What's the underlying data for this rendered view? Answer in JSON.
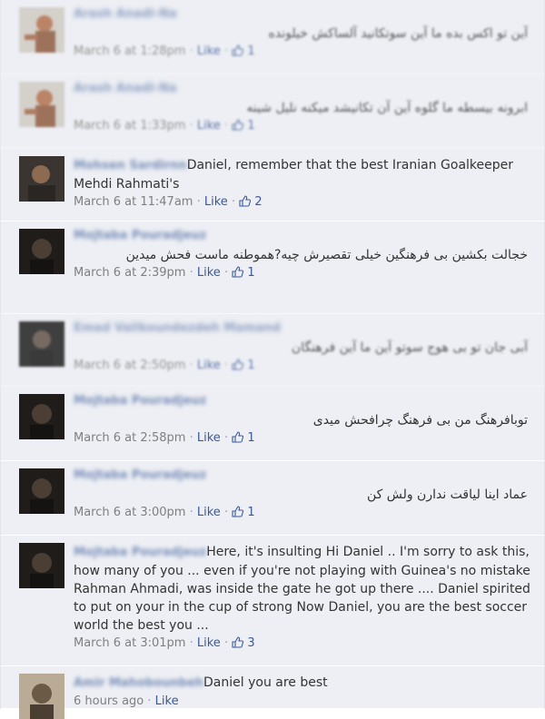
{
  "comments": [
    {
      "author": "Arash Anadi-Na",
      "text": "آين تو اکس بده ما آين سوتکانيد آلساکش خيلونده",
      "time": "March 6 at 1:28pm",
      "like_label": "Like",
      "likes": "1"
    },
    {
      "author": "Arash Anadi-Na",
      "text": "ابرونه بیسطه ما گلوه آين آن تکانیشد میکنه نلیل شینه",
      "time": "March 6 at 1:33pm",
      "like_label": "Like",
      "likes": "1"
    },
    {
      "author": "Mohsen Sardirnn",
      "text": "Daniel, remember that the best Iranian Goalkeeper Mehdi Rahmati's",
      "time": "March 6 at 11:47am",
      "like_label": "Like",
      "likes": "2"
    },
    {
      "author": "Mojtaba Pouradjeuz",
      "text": "خجالت بکشین بی فرهنگین خیلی تقصیرش چیه?هموطنه ماست فحش میدین",
      "time": "March 6 at 2:39pm",
      "like_label": "Like",
      "likes": "1"
    },
    {
      "author": "Emad Valikoundezdeh Mamand",
      "text": "آبی جان تو بی هوج سوتو آين ما آين فرهنگان",
      "time": "March 6 at 2:50pm",
      "like_label": "Like",
      "likes": "1"
    },
    {
      "author": "Mojtaba Pouradjeuz",
      "text": "توبافرهنگ من بی فرهنگ چرافحش میدی",
      "time": "March 6 at 2:58pm",
      "like_label": "Like",
      "likes": "1"
    },
    {
      "author": "Mojtaba Pouradjeuz",
      "text": "عماد اینا لیاقت ندارن ولش کن",
      "time": "March 6 at 3:00pm",
      "like_label": "Like",
      "likes": "1"
    },
    {
      "author": "Mojtaba Pouradjeuz",
      "text": "Here, it's insulting Hi Daniel .. I'm sorry to ask this, how many of you ... even if you're not playing with Guinea's no mistake Rahman Ahmadi, was inside the gate he got up there .... Daniel spirited to put on your in the cup of strong Now Daniel, you are the best soccer world the best you ...",
      "time": "March 6 at 3:01pm",
      "like_label": "Like",
      "likes": "3"
    },
    {
      "author": "Amir Mahobounbeh",
      "text": "Daniel you are best",
      "time": "6 hours ago",
      "like_label": "Like",
      "likes": ""
    }
  ],
  "colors": {
    "link": "#3b5998",
    "meta": "#7f7f7f",
    "bg": "#edeff4"
  },
  "icons": {
    "like": "thumbs-up-icon"
  }
}
